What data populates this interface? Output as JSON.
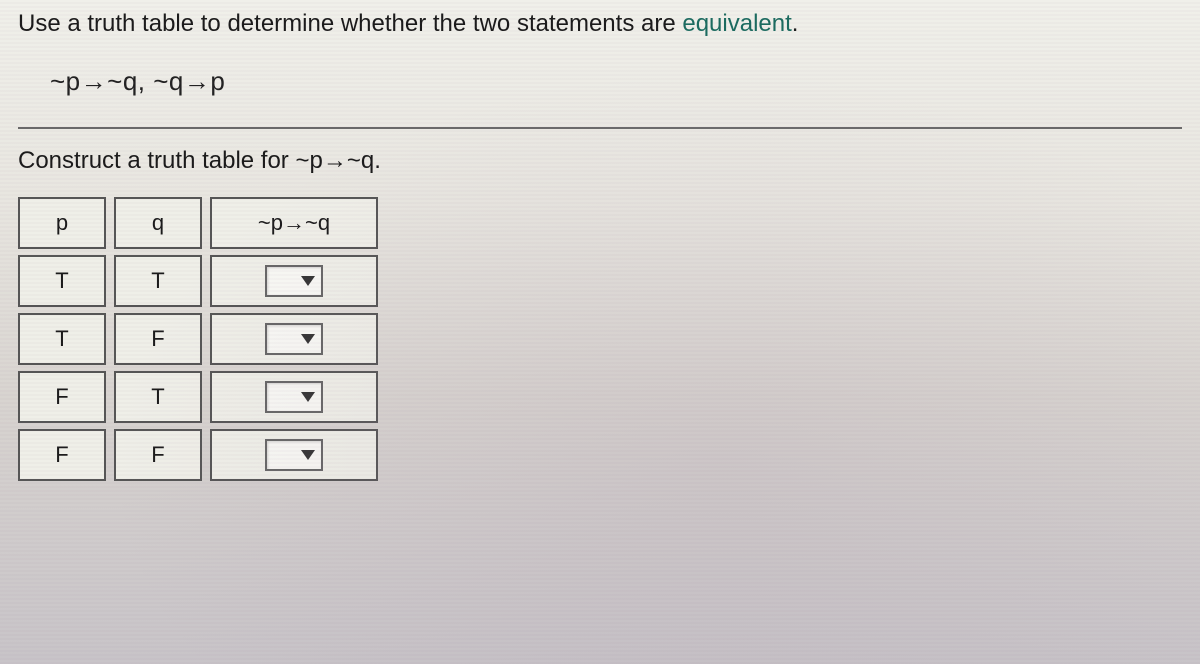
{
  "question": {
    "prefix": "Use a truth table to determine whether the two statements are ",
    "link_word": "equivalent",
    "suffix": "."
  },
  "statements": "~p→~q, ~q→p",
  "instruction": "Construct a truth table for ~p→~q.",
  "table": {
    "headers": {
      "p": "p",
      "q": "q",
      "result": "~p→~q"
    },
    "rows": [
      {
        "p": "T",
        "q": "T",
        "result": ""
      },
      {
        "p": "T",
        "q": "F",
        "result": ""
      },
      {
        "p": "F",
        "q": "T",
        "result": ""
      },
      {
        "p": "F",
        "q": "F",
        "result": ""
      }
    ]
  }
}
